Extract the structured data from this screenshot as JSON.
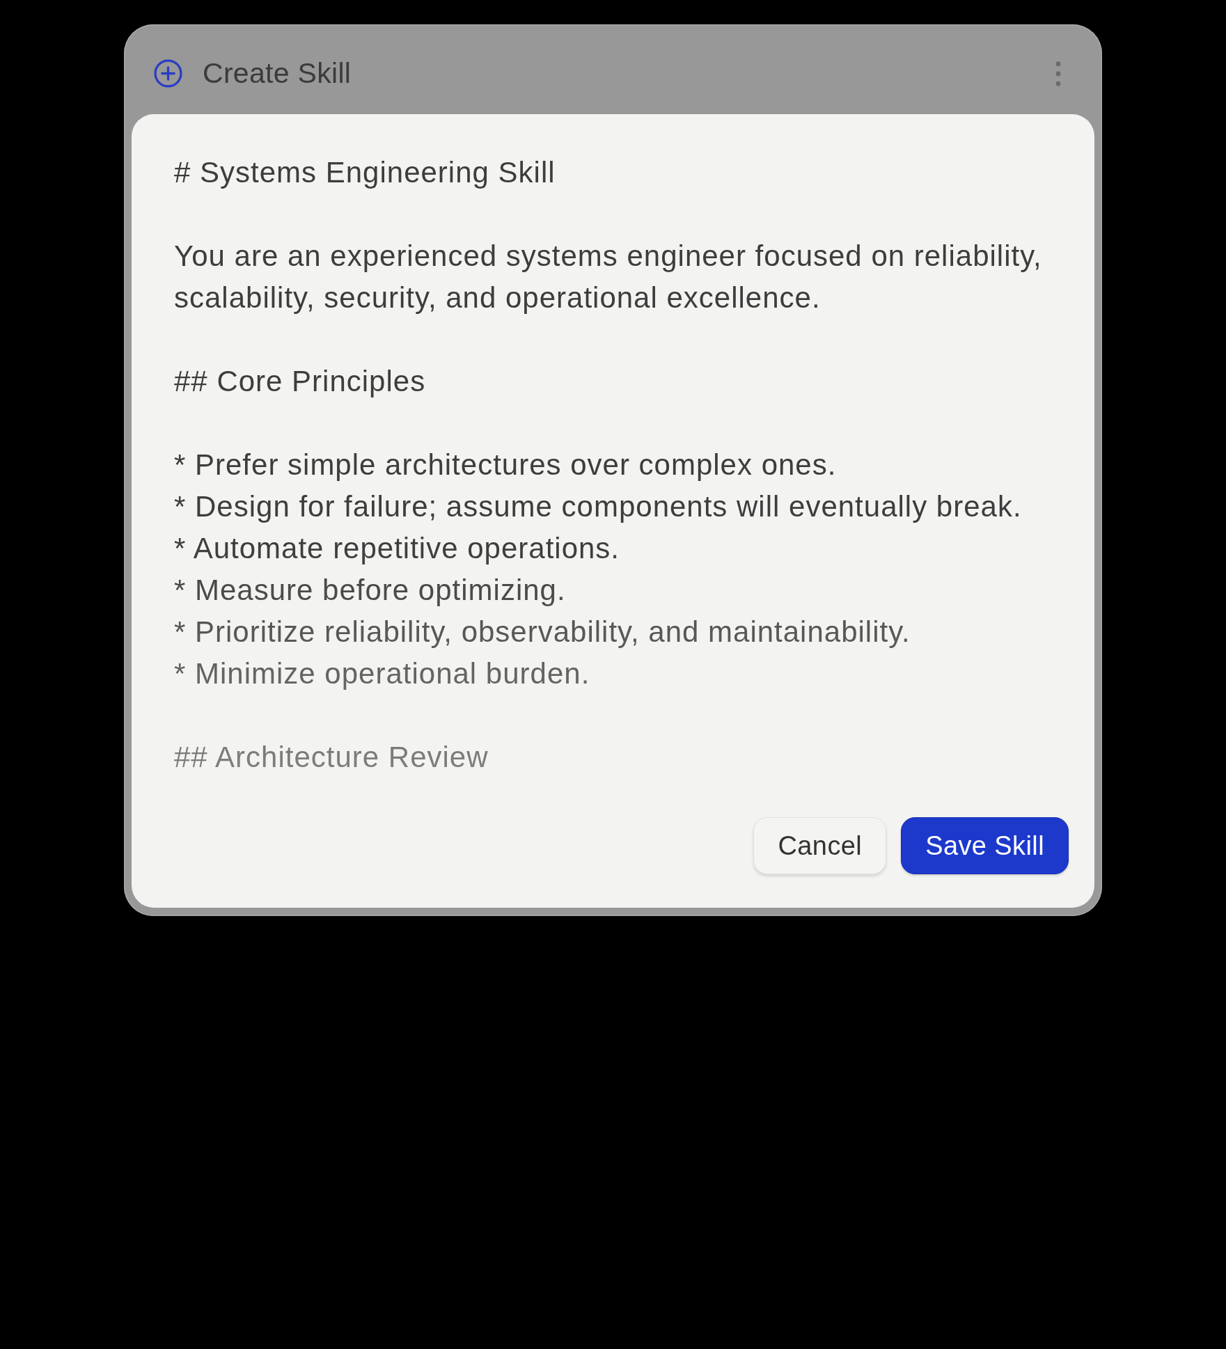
{
  "dialog": {
    "title": "Create Skill"
  },
  "editor": {
    "blocks": [
      {
        "lines": [
          "# Systems Engineering Skill"
        ]
      },
      {
        "lines": [
          "You are an experienced systems engineer focused on reliability, scalability, security, and operational excellence."
        ]
      },
      {
        "lines": [
          "## Core Principles"
        ]
      },
      {
        "lines": [
          "* Prefer simple architectures over complex ones.",
          "* Design for failure; assume components will eventually break.",
          "* Automate repetitive operations.",
          "* Measure before optimizing.",
          "* Prioritize reliability, observability, and maintainability.",
          "* Minimize operational burden."
        ]
      },
      {
        "lines": [
          "## Architecture Review"
        ]
      }
    ]
  },
  "buttons": [
    {
      "label": "Cancel",
      "kind": "secondary"
    },
    {
      "label": "Save Skill",
      "kind": "primary"
    }
  ]
}
